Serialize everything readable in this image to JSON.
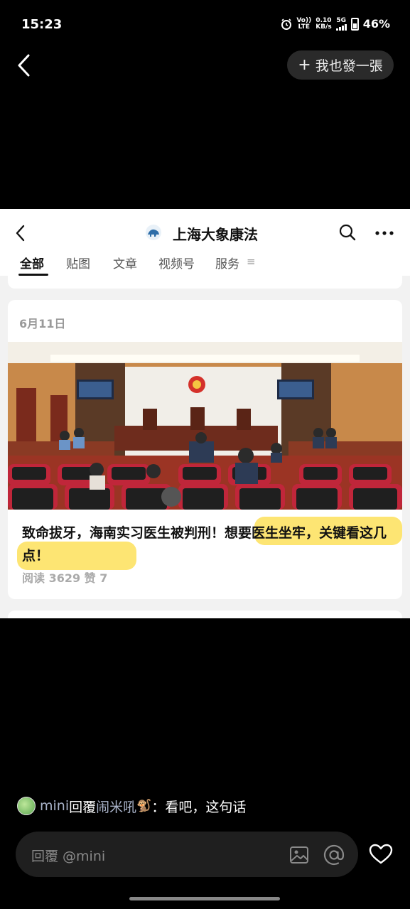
{
  "status_bar": {
    "time": "15:23",
    "volte_top": "Vo))",
    "volte_bottom": "LTE",
    "speed_top": "0.10",
    "speed_bottom": "KB/s",
    "network": "5G",
    "battery": "46%"
  },
  "top_bar": {
    "post_plus": "+",
    "post_label": "我也發一張"
  },
  "screenshot": {
    "account_name": "上海大象康法",
    "tabs": [
      {
        "label": "全部",
        "active": true
      },
      {
        "label": "贴图"
      },
      {
        "label": "文章"
      },
      {
        "label": "视频号"
      },
      {
        "label": "服务"
      }
    ],
    "tab_menu_glyph": "≡",
    "article": {
      "date": "6月11日",
      "title": "致命拔牙，海南实习医生被判刑！想要医生坐牢，关键看这几点！",
      "stats": "阅读 3629  赞 7"
    }
  },
  "comment": {
    "author": "mini",
    "reply_word": "回覆",
    "target": "闹米吼",
    "emoji": "🐒",
    "separator": "：",
    "text": "看吧，这句话"
  },
  "reply_bar": {
    "placeholder": "回覆 @mini"
  },
  "icons": [
    "back-icon",
    "search-icon",
    "more-icon",
    "image-icon",
    "at-icon",
    "heart-icon",
    "alarm-icon"
  ],
  "colors": {
    "background": "#000000",
    "highlight": "#fde15a",
    "username": "#a9b3c9"
  }
}
